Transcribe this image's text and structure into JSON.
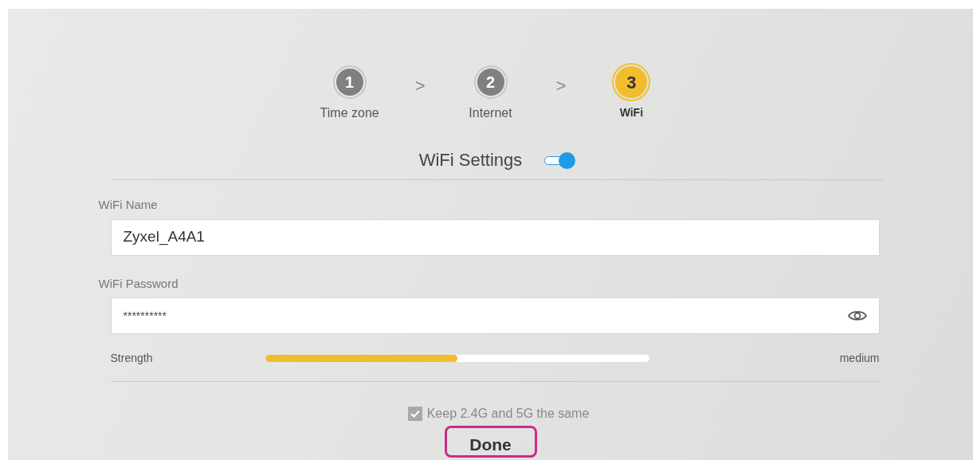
{
  "steps": [
    {
      "number": "1",
      "label": "Time zone",
      "selected": false
    },
    {
      "separator": ">"
    },
    {
      "number": "2",
      "label": "Internet",
      "selected": false
    },
    {
      "separator": ">"
    },
    {
      "number": "3",
      "label": "WiFi",
      "selected": true
    }
  ],
  "section": {
    "title": "WiFi Settings",
    "on": true
  },
  "wifi_name": {
    "label": "WiFi Name",
    "value": "Zyxel_A4A1"
  },
  "wifi_password": {
    "label": "WiFi Password",
    "value": "**********"
  },
  "strength": {
    "label": "Strength",
    "level": 0.5,
    "reading": "medium"
  },
  "keep_same": {
    "label": "Keep 2.4G and 5G the same",
    "checked": true
  },
  "done_button": {
    "label": "Done"
  }
}
